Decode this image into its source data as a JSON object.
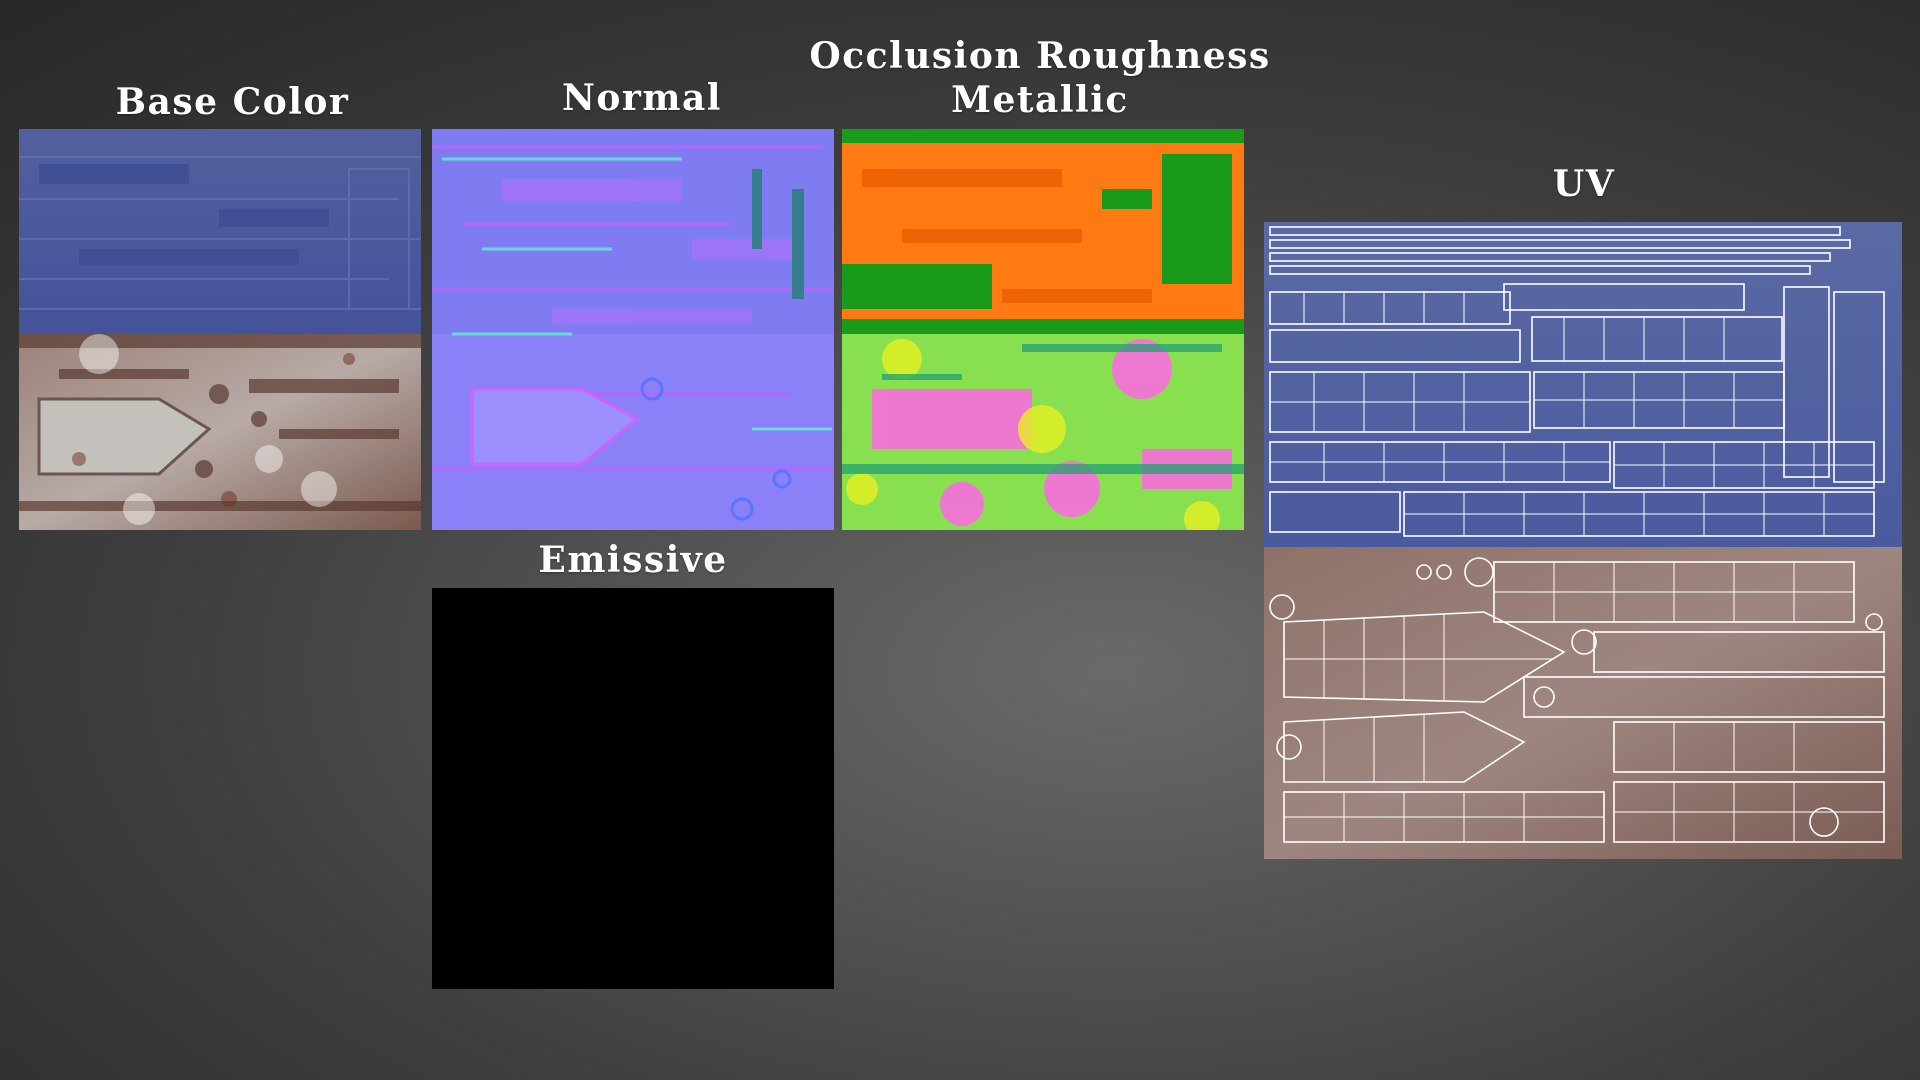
{
  "panels": {
    "base_color": {
      "title": "Base Color"
    },
    "normal": {
      "title": "Normal"
    },
    "orm": {
      "title_line1": "Occlusion Roughness",
      "title_line2": "Metallic"
    },
    "emissive": {
      "title": "Emissive"
    },
    "uv": {
      "title": "UV"
    }
  },
  "colors": {
    "background_center": "#6a6a6a",
    "background_edge": "#262626",
    "label_text": "#ffffff",
    "base_blue": "#4a5a9e",
    "base_rust": "#8a6e62",
    "normal_purple": "#7f7fff",
    "orm_orange": "#ff7a10",
    "orm_green": "#1a9a1a",
    "orm_magenta": "#ff60e0",
    "emissive_black": "#000000",
    "uv_wire": "#ffffff"
  }
}
